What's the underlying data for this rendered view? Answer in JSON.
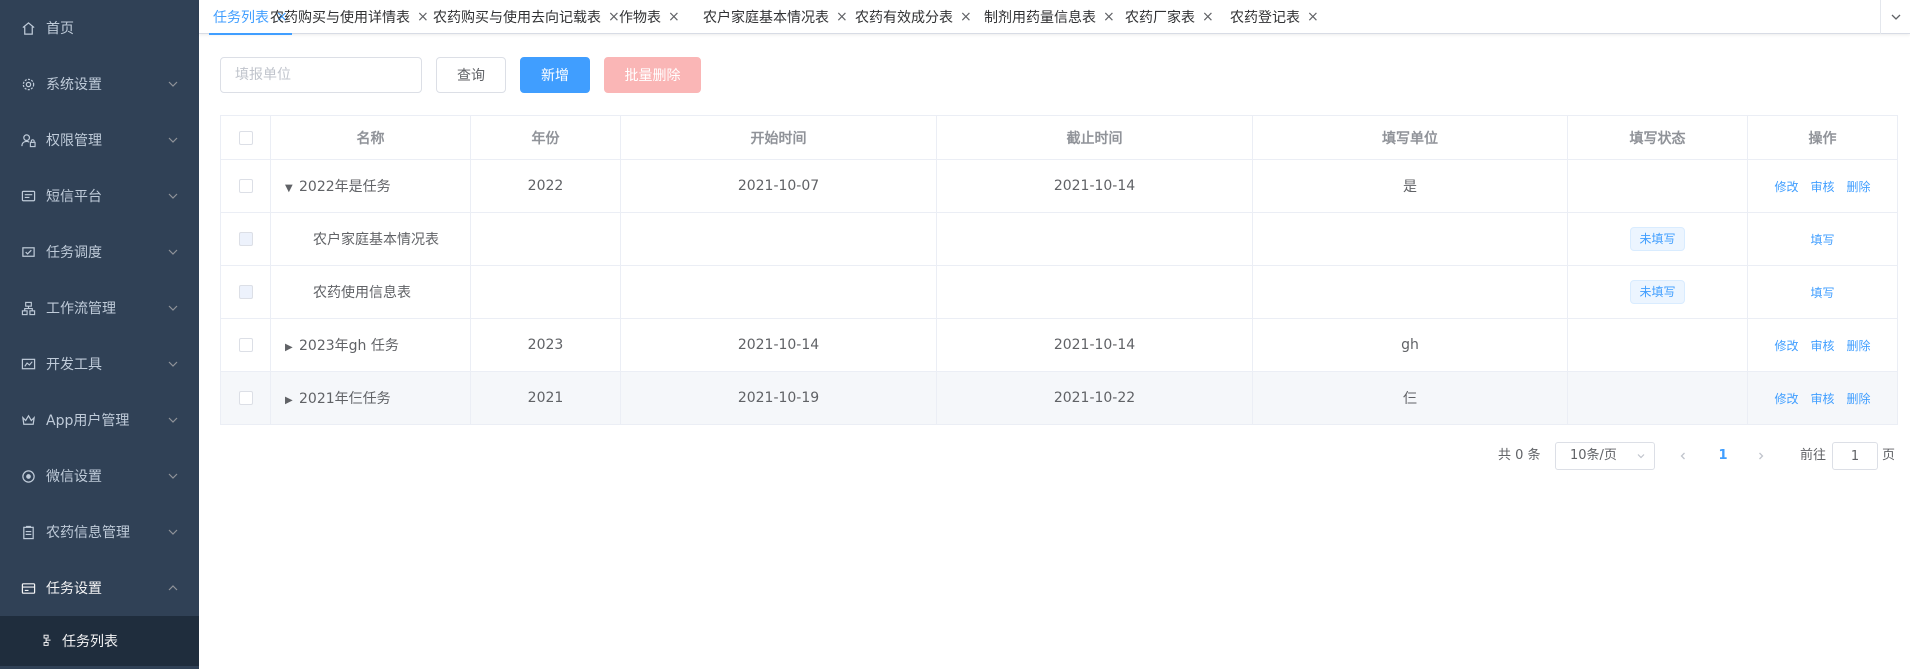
{
  "sidebar": {
    "items": [
      {
        "label": "首页",
        "icon": "home-icon",
        "has_arrow": false
      },
      {
        "label": "系统设置",
        "icon": "gear-icon",
        "has_arrow": true
      },
      {
        "label": "权限管理",
        "icon": "user-lock-icon",
        "has_arrow": true
      },
      {
        "label": "短信平台",
        "icon": "message-icon",
        "has_arrow": true
      },
      {
        "label": "任务调度",
        "icon": "task-schedule-icon",
        "has_arrow": true
      },
      {
        "label": "工作流管理",
        "icon": "workflow-icon",
        "has_arrow": true
      },
      {
        "label": "开发工具",
        "icon": "dev-tools-icon",
        "has_arrow": true
      },
      {
        "label": "App用户管理",
        "icon": "crown-icon",
        "has_arrow": true
      },
      {
        "label": "微信设置",
        "icon": "wechat-icon",
        "has_arrow": true
      },
      {
        "label": "农药信息管理",
        "icon": "clipboard-icon",
        "has_arrow": true
      },
      {
        "label": "任务设置",
        "icon": "card-icon",
        "has_arrow": true,
        "open": true
      }
    ],
    "sub_items": [
      {
        "label": "任务列表",
        "icon": "tree-icon"
      }
    ]
  },
  "tabs": [
    {
      "label": "任务列表",
      "active": true
    },
    {
      "label": "农药购买与使用详情表"
    },
    {
      "label": "农药购买与使用去向记载表"
    },
    {
      "label": "作物表"
    },
    {
      "label": "农户家庭基本情况表"
    },
    {
      "label": "农药有效成分表"
    },
    {
      "label": "制剂用药量信息表"
    },
    {
      "label": "农药厂家表"
    },
    {
      "label": "农药登记表"
    }
  ],
  "toolbar": {
    "search_placeholder": "填报单位",
    "search_value": "",
    "query_label": "查询",
    "add_label": "新增",
    "batch_delete_label": "批量删除"
  },
  "table": {
    "headers": [
      "名称",
      "年份",
      "开始时间",
      "截止时间",
      "填写单位",
      "填写状态",
      "操作"
    ],
    "rows": [
      {
        "name": "2022年是任务",
        "year": "2022",
        "start": "2021-10-07",
        "end": "2021-10-14",
        "unit": "是",
        "status": "",
        "expanded": true,
        "level": 0,
        "ops": [
          "修改",
          "审核",
          "删除"
        ]
      },
      {
        "name": "农户家庭基本情况表",
        "year": "",
        "start": "",
        "end": "",
        "unit": "",
        "status": "未填写",
        "level": 1,
        "ops": [
          "填写"
        ]
      },
      {
        "name": "农药使用信息表",
        "year": "",
        "start": "",
        "end": "",
        "unit": "",
        "status": "未填写",
        "level": 1,
        "ops": [
          "填写"
        ]
      },
      {
        "name": "2023年gh 任务",
        "year": "2023",
        "start": "2021-10-14",
        "end": "2021-10-14",
        "unit": "gh",
        "status": "",
        "expanded": false,
        "level": 0,
        "ops": [
          "修改",
          "审核",
          "删除"
        ]
      },
      {
        "name": "2021年仨任务",
        "year": "2021",
        "start": "2021-10-19",
        "end": "2021-10-22",
        "unit": "仨",
        "status": "",
        "expanded": false,
        "level": 0,
        "ops": [
          "修改",
          "审核",
          "删除"
        ],
        "hover": true
      }
    ]
  },
  "pagination": {
    "total_text": "共 0 条",
    "page_size": "10条/页",
    "current_page": "1",
    "goto_label": "前往",
    "goto_value": "1",
    "goto_suffix": "页"
  },
  "colors": {
    "sidebar_bg": "#304156",
    "submenu_bg": "#1f2d3d",
    "primary": "#409eff",
    "danger_disabled": "#fab6b6"
  }
}
